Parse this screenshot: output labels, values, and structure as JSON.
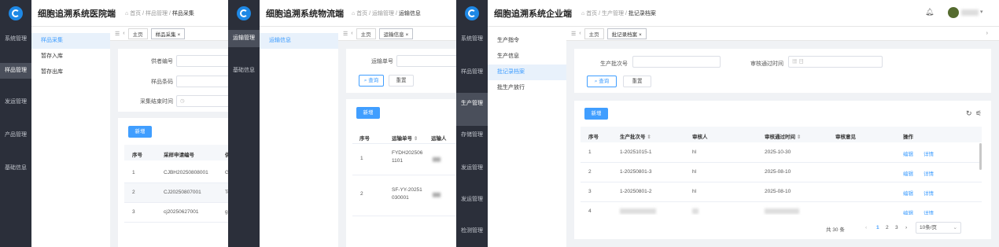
{
  "hospital": {
    "title": "细胞追溯系统医院端",
    "rail": [
      "系统管理",
      "样品管理",
      "发运管理",
      "产品管理",
      "基础信息"
    ],
    "crumbs": [
      "首页",
      "样品管理",
      "样品采集"
    ],
    "tab": "样品采集",
    "submenu": [
      "样品采集",
      "暂存入库",
      "暂存出库"
    ],
    "filters": [
      "供者编号",
      "样品条码",
      "采集结束时间"
    ],
    "new_btn": "新增",
    "columns": [
      "序号",
      "采样申请编号",
      "供"
    ],
    "rows": [
      [
        "1",
        "CJBH20250808001",
        "G"
      ],
      [
        "2",
        "CJ20250807001",
        "Te"
      ],
      [
        "3",
        "cj20250627001",
        "g"
      ]
    ]
  },
  "logistics": {
    "title": "细胞追溯系统物流端",
    "rail": [
      "运输管理",
      "基础信息"
    ],
    "crumbs": [
      "首页",
      "运输管理",
      "运输信息"
    ],
    "tabs": [
      "主页",
      "运输信息"
    ],
    "submenu": [
      "运输信息"
    ],
    "filter_label": "运输单号",
    "search_btn": "查询",
    "reset_btn": "重置",
    "new_btn": "新增",
    "columns": [
      "序号",
      "运输单号",
      "运输人"
    ],
    "rows": [
      [
        "1",
        "FYDH202506",
        "1101"
      ],
      [
        "2",
        "SF-YY-20251",
        "030001"
      ]
    ]
  },
  "enterprise": {
    "title": "细胞追溯系统企业端",
    "rail": [
      "系统管理",
      "样品管理",
      "生产管理",
      "存储管理",
      "发运管理",
      "发运管理",
      "检测管理"
    ],
    "crumbs": [
      "首页",
      "生产管理",
      "批记录档案"
    ],
    "tabs": [
      "主页",
      "批记录档案"
    ],
    "submenu": [
      "生产指令",
      "生产信息",
      "批记录档案",
      "批生产放行"
    ],
    "filters": {
      "batch_label": "生产批次号",
      "time_label": "审核通过时间",
      "time_placeholder": "日"
    },
    "search_btn": "查询",
    "reset_btn": "重置",
    "new_btn": "新增",
    "columns": [
      "序号",
      "生产批次号",
      "审核人",
      "审核通过时间",
      "审核意见",
      "操作"
    ],
    "rows": [
      [
        "1",
        "1-20251015-1",
        "hl",
        "2025-10-30"
      ],
      [
        "2",
        "1-20250801-3",
        "hl",
        "2025-08-10"
      ],
      [
        "3",
        "1-20250801-2",
        "hl",
        "2025-08-10"
      ],
      [
        "4",
        "",
        "",
        ""
      ]
    ],
    "edit_label": "编辑",
    "detail_label": "详情",
    "pagination": {
      "total": "共 30 条",
      "pages": [
        "1",
        "2",
        "3"
      ],
      "page_size": "10条/页"
    }
  }
}
